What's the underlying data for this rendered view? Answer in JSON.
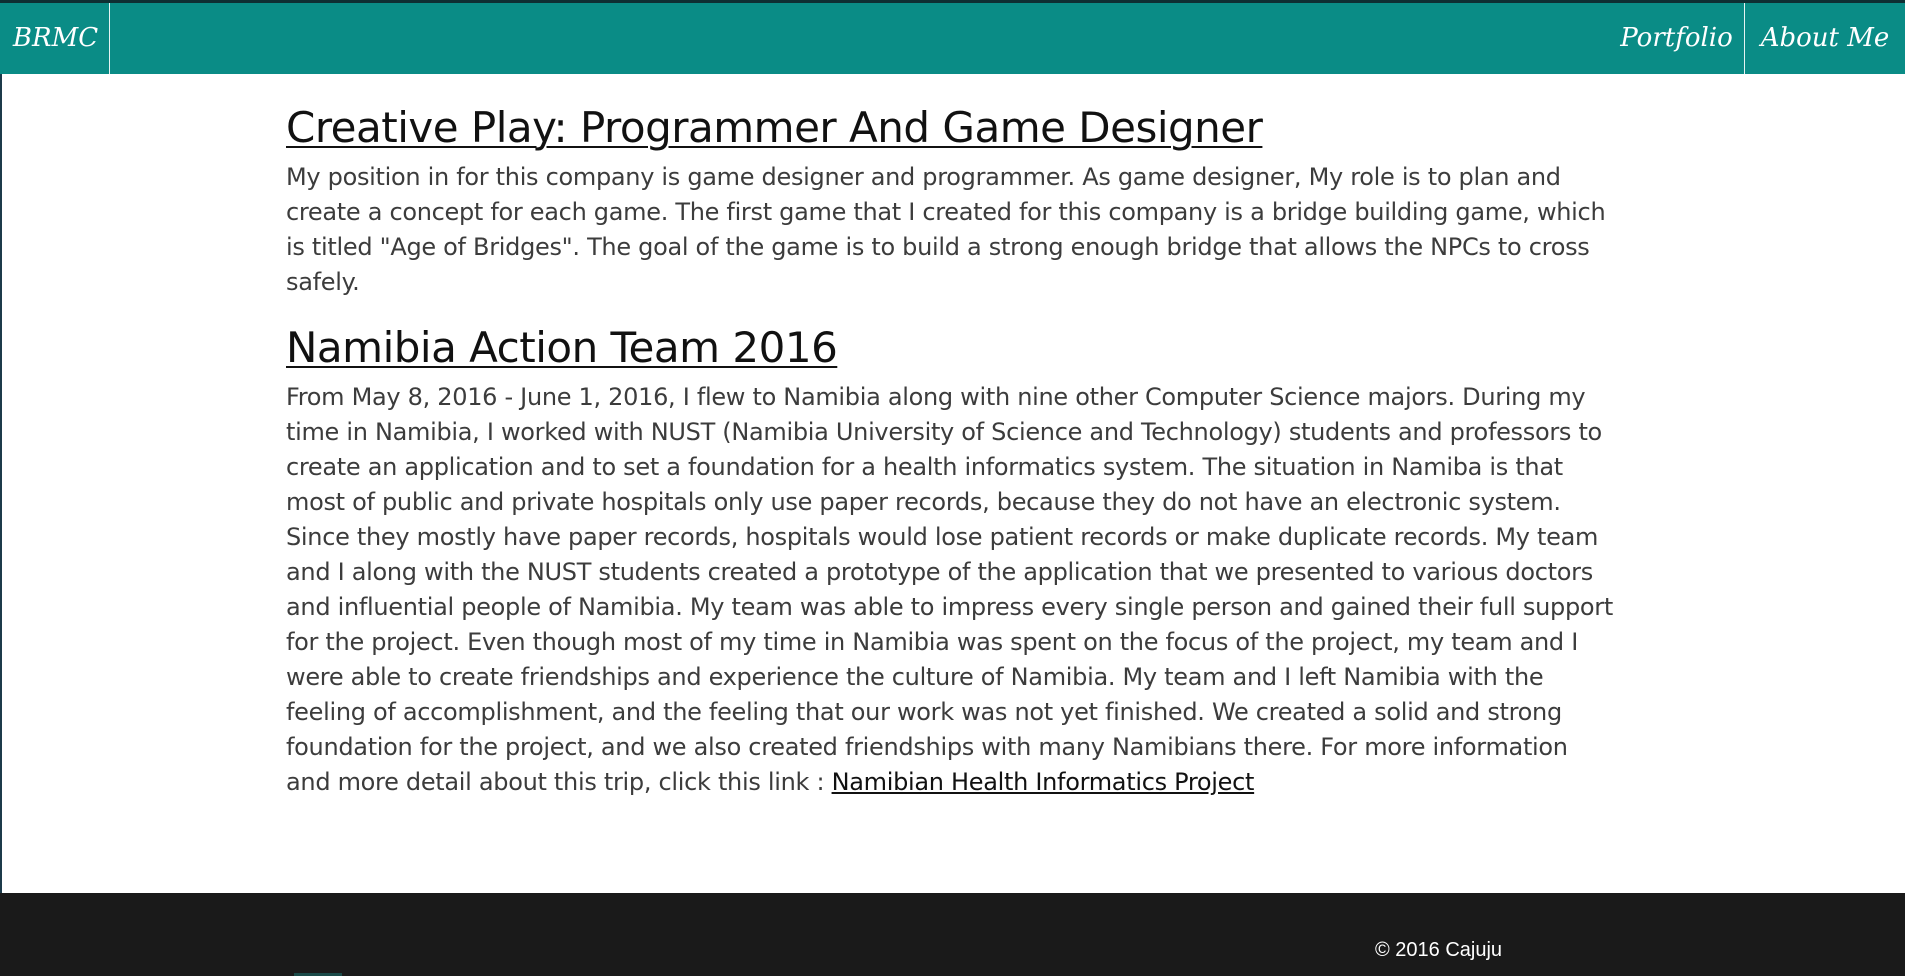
{
  "navbar": {
    "brand": "BRMC",
    "items": [
      {
        "label": "Portfolio"
      },
      {
        "label": "About Me"
      }
    ],
    "background": "#0a8c86"
  },
  "sections": [
    {
      "title": "Creative Play: Programmer And Game Designer",
      "body": "My position in for this company is game designer and programmer. As game designer, My role is to plan and create a concept for each game. The first game that I created for this company is a bridge building game, which is titled \"Age of Bridges\". The goal of the game is to build a strong enough bridge that allows the NPCs to cross safely."
    },
    {
      "title": "Namibia Action Team 2016",
      "body": "From May 8, 2016 - June 1, 2016, I flew to Namibia along with nine other Computer Science majors. During my time in Namibia, I worked with NUST (Namibia University of Science and Technology) students and professors to create an application and to set a foundation for a health informatics system. The situation in Namiba is that most of public and private hospitals only use paper records, because they do not have an electronic system. Since they mostly have paper records, hospitals would lose patient records or make duplicate records. My team and I along with the NUST students created a prototype of the application that we presented to various doctors and influential people of Namibia. My team was able to impress every single person and gained their full support for the project. Even though most of my time in Namibia was spent on the focus of the project, my team and I were able to create friendships and experience the culture of Namibia. My team and I left Namibia with the feeling of accomplishment, and the feeling that our work was not yet finished. We created a solid and strong foundation for the project, and we also created friendships with many Namibians there. For more information and more detail about this trip, click this link : ",
      "link_text": "Namibian Health Informatics Project"
    }
  ],
  "footer": {
    "copyright": "© 2016 Cajuju",
    "background": "#1a1a1a"
  }
}
